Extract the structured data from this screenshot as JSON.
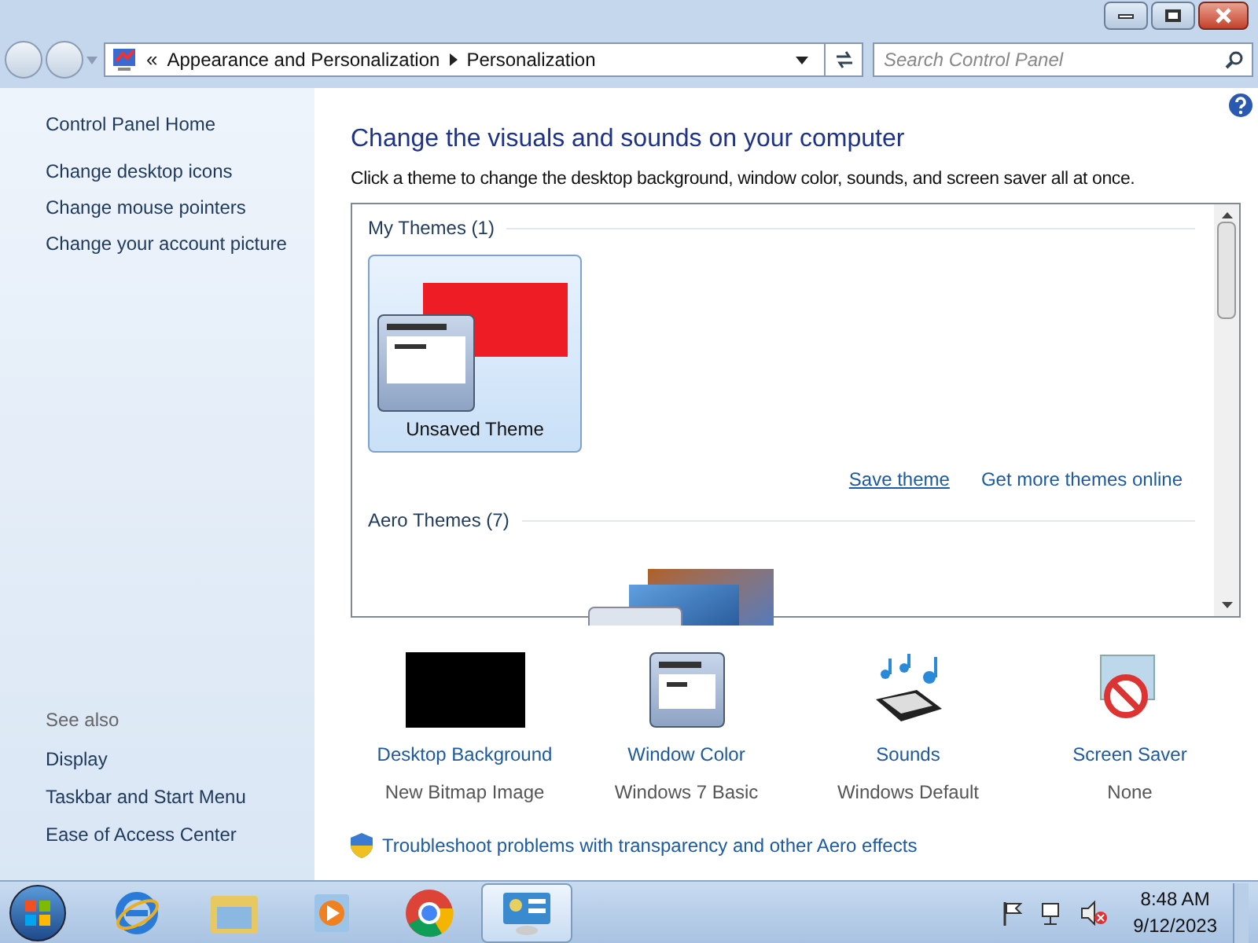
{
  "address_bar": {
    "chevron": "«",
    "crumbs": [
      "Appearance and Personalization",
      "Personalization"
    ]
  },
  "search": {
    "placeholder": "Search Control Panel"
  },
  "sidebar": {
    "items": [
      "Control Panel Home",
      "Change desktop icons",
      "Change mouse pointers",
      "Change your account picture"
    ],
    "see_also": {
      "heading": "See also",
      "items": [
        "Display",
        "Taskbar and Start Menu",
        "Ease of Access Center"
      ]
    }
  },
  "main": {
    "heading": "Change the visuals and sounds on your computer",
    "subtitle": "Click a theme to change the desktop background, window color, sounds, and screen saver all at once.",
    "groups": [
      {
        "title": "My Themes (1)",
        "items": [
          {
            "name": "Unsaved Theme",
            "selected": true
          }
        ]
      },
      {
        "title": "Aero Themes (7)"
      }
    ],
    "links": [
      "Save theme",
      "Get more themes online"
    ],
    "settings": [
      {
        "kind": "background",
        "label": "Desktop Background",
        "value": "New Bitmap Image"
      },
      {
        "kind": "color",
        "label": "Window Color",
        "value": "Windows 7 Basic"
      },
      {
        "kind": "sounds",
        "label": "Sounds",
        "value": "Windows Default"
      },
      {
        "kind": "screensaver",
        "label": "Screen Saver",
        "value": "None"
      }
    ],
    "troubleshoot": "Troubleshoot problems with transparency and other Aero effects"
  },
  "taskbar": {
    "items": [
      {
        "kind": "ie",
        "selected": false
      },
      {
        "kind": "explorer",
        "selected": false
      },
      {
        "kind": "media",
        "selected": false
      },
      {
        "kind": "chrome",
        "selected": false
      },
      {
        "kind": "control",
        "selected": true
      }
    ],
    "time": "8:48 AM",
    "date": "9/12/2023"
  }
}
